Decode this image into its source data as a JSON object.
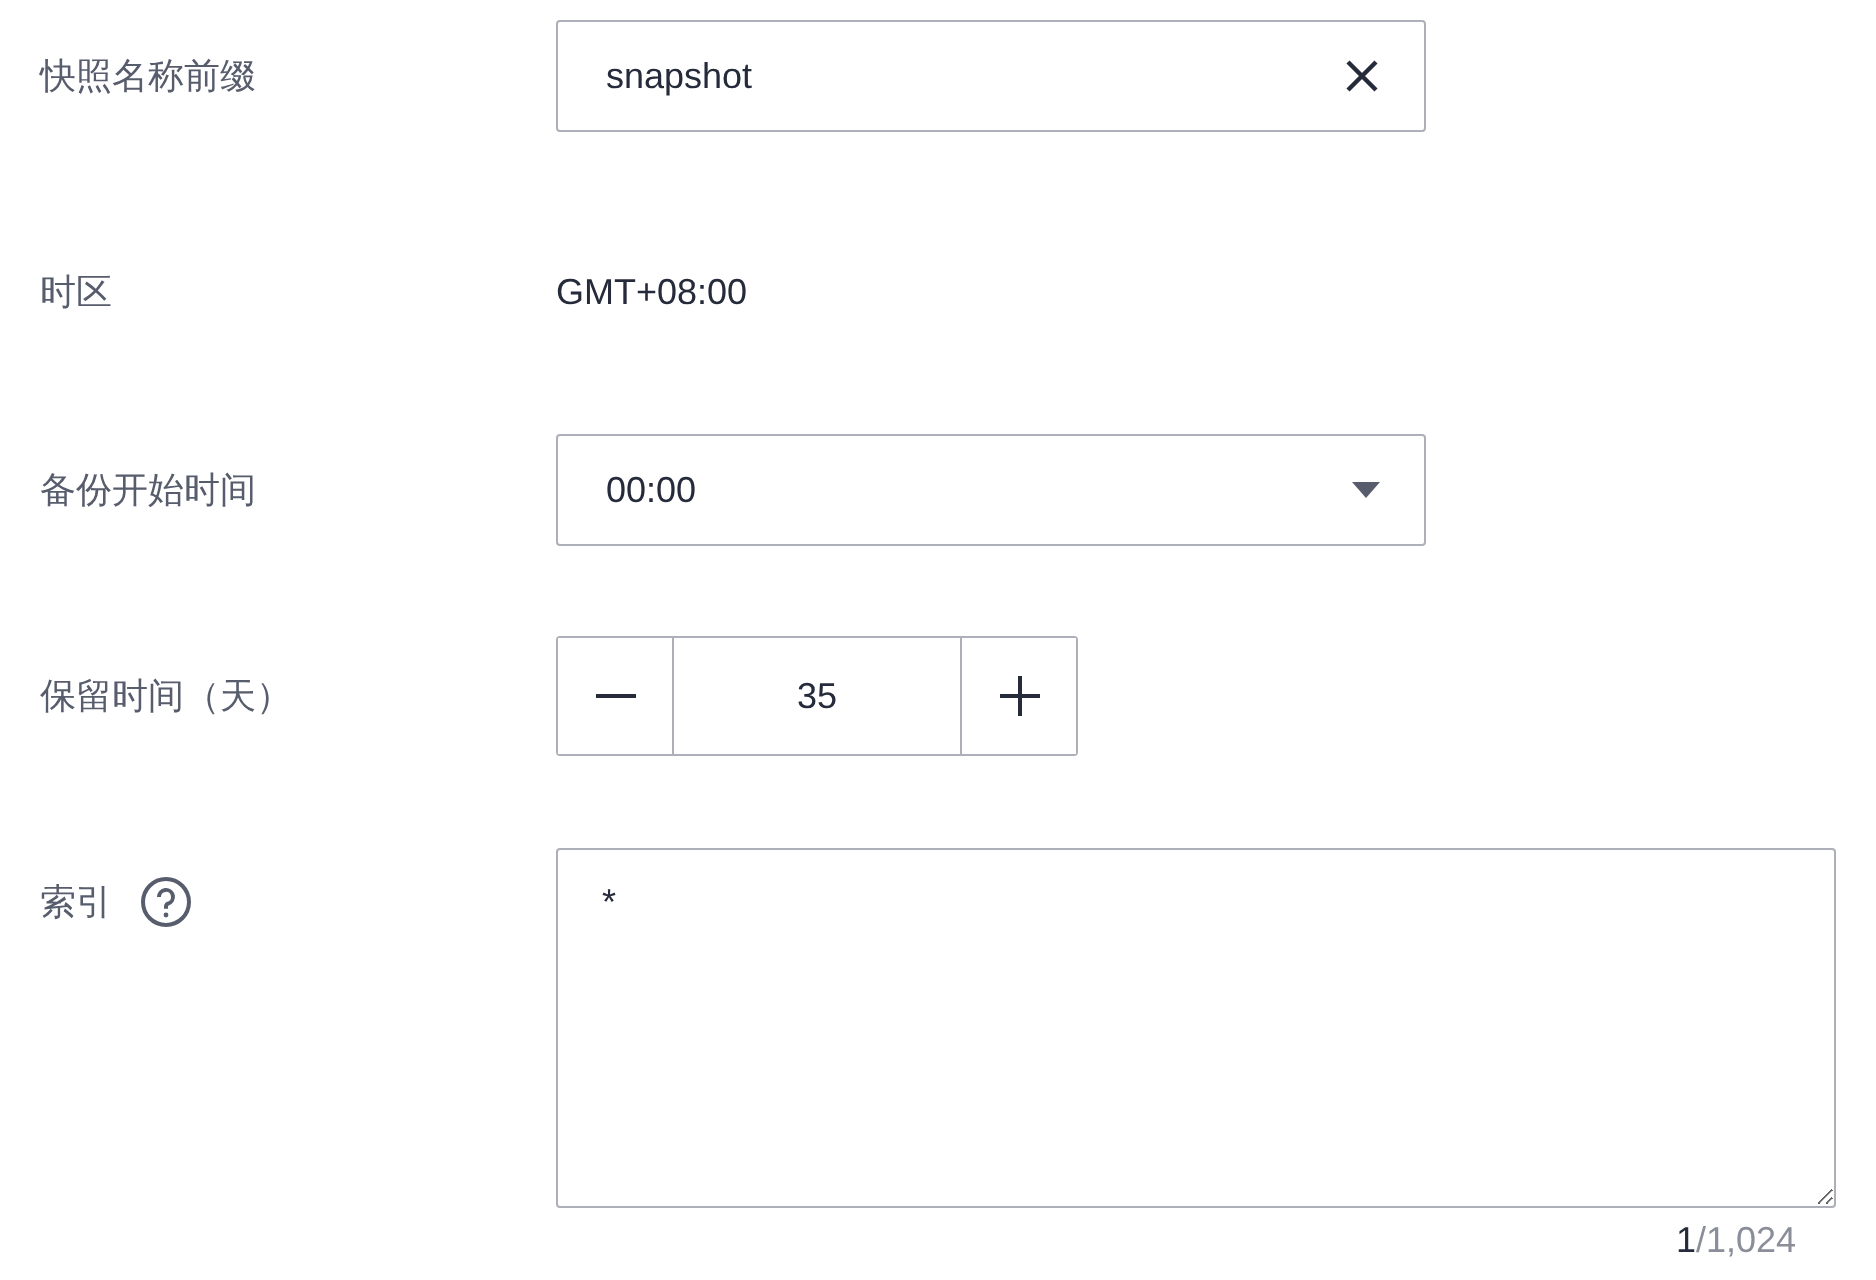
{
  "form": {
    "rows": [
      {
        "kind": "text",
        "label": "快照名称前缀",
        "value": "snapshot",
        "clearable": true
      },
      {
        "kind": "static",
        "label": "时区",
        "value": "GMT+08:00"
      },
      {
        "kind": "select",
        "label": "备份开始时间",
        "value": "00:00"
      },
      {
        "kind": "stepper",
        "label": "保留时间（天）",
        "value": "35"
      },
      {
        "kind": "textarea",
        "label": "索引",
        "help": true,
        "value": "*",
        "counter": {
          "current": "1",
          "total": "/1,024"
        }
      }
    ]
  }
}
